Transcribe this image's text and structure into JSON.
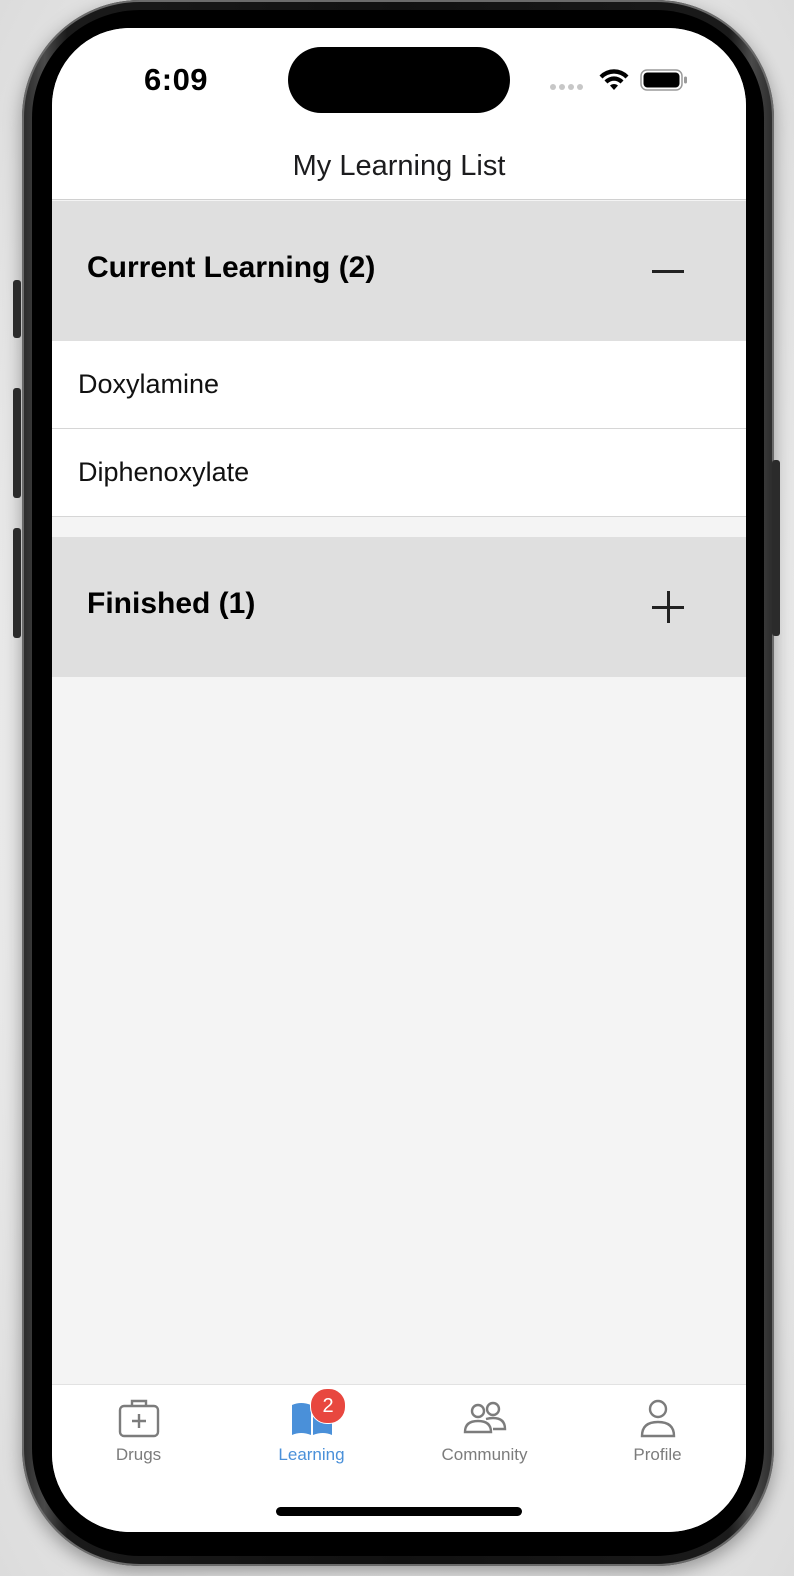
{
  "status_bar": {
    "time": "6:09"
  },
  "header": {
    "title": "My Learning List"
  },
  "sections": [
    {
      "title": "Current Learning (2)",
      "expanded": true,
      "toggle_icon": "minus-icon",
      "items": [
        "Doxylamine",
        "Diphenoxylate"
      ]
    },
    {
      "title": "Finished (1)",
      "expanded": false,
      "toggle_icon": "plus-icon",
      "items": []
    }
  ],
  "tab_bar": {
    "active_color": "#4a90d9",
    "inactive_color": "#7c7c7c",
    "badge_color": "#e8473f",
    "tabs": [
      {
        "label": "Drugs",
        "icon": "medical-kit-icon",
        "active": false
      },
      {
        "label": "Learning",
        "icon": "open-book-icon",
        "active": true,
        "badge": "2"
      },
      {
        "label": "Community",
        "icon": "people-icon",
        "active": false
      },
      {
        "label": "Profile",
        "icon": "person-icon",
        "active": false
      }
    ]
  }
}
